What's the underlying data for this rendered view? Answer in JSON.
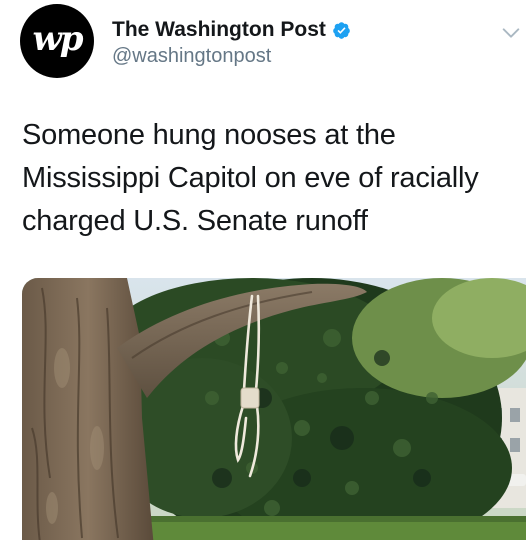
{
  "author": {
    "display_name": "The Washington Post",
    "handle": "@washingtonpost",
    "avatar_monogram": "wp",
    "verified": true,
    "verified_icon": "verified-badge-icon",
    "menu_icon": "chevron-down-icon"
  },
  "tweet": {
    "text_lines": [
      "Someone hung nooses at the",
      "Mississippi Capitol on eve of racially",
      "charged U.S. Senate runoff"
    ]
  },
  "media": {
    "kind": "photo",
    "subject_icon": "tree-with-noose-photo"
  },
  "colors": {
    "text": "#14171a",
    "secondary_text": "#657786",
    "verified_blue": "#1da1f2",
    "avatar_bg": "#000000"
  }
}
